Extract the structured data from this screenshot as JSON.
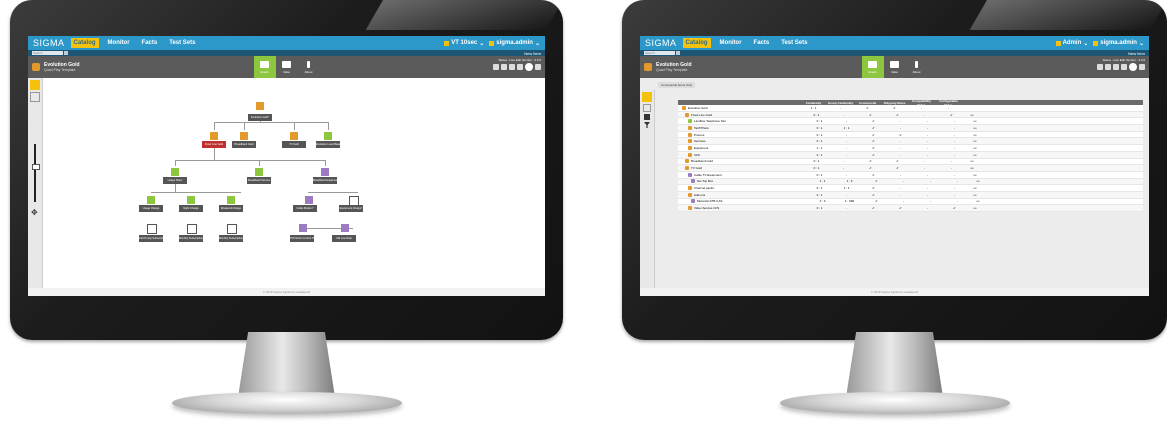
{
  "app": {
    "logo": "SIGMA",
    "nav": [
      "Catalog",
      "Monitor",
      "Facts",
      "Test Sets"
    ],
    "search_placeholder": "Search",
    "new_item": "New Item",
    "footer": "© 2019 Sigma Systems Canada LP"
  },
  "left": {
    "user1": "VT 10sec",
    "user2": "sigma.admin",
    "title": "Evolution Gold",
    "subtitle": "Quad Play Template",
    "modes": [
      "Graph",
      "Data",
      "About"
    ],
    "status": "Status : Live Edit  Version : 4.3.0",
    "nodes": [
      "Evolution Gold*",
      "Fixed Line Gold",
      "Broadband Gold",
      "TV Gold",
      "Evolution Level Based Discount",
      "Usage Plans",
      "Broadband Service",
      "Broadband Equipment",
      "Usage Charge",
      "Night Charge",
      "Weekend Charge",
      "Cable Modem*",
      "Equipment Charge*",
      "Call Timely Subscription Charge*",
      "Monthly Subscription Charge*",
      "Monthly Subscription Charge*",
      "TM Nimbo Control TSV",
      "CM Low Rate"
    ],
    "colors": {
      "green": "#8dc63f",
      "orange": "#e39a2b",
      "purple": "#9b7cc1",
      "red": "#bf2f2f"
    }
  },
  "right": {
    "user1": "Admin",
    "user2": "sigma.admin",
    "title": "Evolution Gold",
    "subtitle": "Quad Play Template",
    "modes": [
      "Graph",
      "Data",
      "About"
    ],
    "status": "Status : Live Edit  Version : 4.3.0",
    "tag": "Commercial Items Only",
    "columns": [
      "",
      "Cardinality",
      "Group Cardinality",
      "Commercial",
      "Shipping Rules",
      "Compatibility Rules",
      "Configurable Rules",
      ""
    ],
    "rows": [
      {
        "name": "Evolution Gold",
        "card": "1 : 1",
        "group": "-",
        "comm": "✔",
        "ship": "✔",
        "compat": "-",
        "conf": "-",
        "more": ""
      },
      {
        "name": "Fixed Line Gold",
        "card": "0 : 1",
        "group": "-",
        "comm": "✔",
        "ship": "✔",
        "compat": "-",
        "conf": "✔",
        "more": "•••"
      },
      {
        "name": "Landline Telephone Sim",
        "card": "0 : 1",
        "group": "-",
        "comm": "✔",
        "ship": "-",
        "compat": "-",
        "conf": "-",
        "more": "•••"
      },
      {
        "name": "Tariff Plans",
        "card": "0 : 1",
        "group": "1 : 1",
        "comm": "✔",
        "ship": "-",
        "compat": "-",
        "conf": "-",
        "more": "•••"
      },
      {
        "name": "Promos",
        "card": "0 : 1",
        "group": "-",
        "comm": "✔",
        "ship": "✔",
        "compat": "-",
        "conf": "-",
        "more": "•••"
      },
      {
        "name": "Services",
        "card": "0 : 1",
        "group": "-",
        "comm": "✔",
        "ship": "-",
        "compat": "-",
        "conf": "-",
        "more": "•••"
      },
      {
        "name": "Equipment",
        "card": "1 : 1",
        "group": "-",
        "comm": "✔",
        "ship": "-",
        "compat": "-",
        "conf": "-",
        "more": "•••"
      },
      {
        "name": "VAS",
        "card": "0 : 1",
        "group": "-",
        "comm": "✔",
        "ship": "-",
        "compat": "-",
        "conf": "-",
        "more": "•••"
      },
      {
        "name": "Broadband Gold",
        "card": "0 : 1",
        "group": "-",
        "comm": "✔",
        "ship": "✔",
        "compat": "-",
        "conf": "-",
        "more": "•••"
      },
      {
        "name": "TV Gold",
        "card": "0 : 1",
        "group": "-",
        "comm": "✔",
        "ship": "✔",
        "compat": "-",
        "conf": "-",
        "more": "•••"
      },
      {
        "name": "Cable TV Equipment",
        "card": "0 : 1",
        "group": "-",
        "comm": "✔",
        "ship": "-",
        "compat": "-",
        "conf": "-",
        "more": "•••"
      },
      {
        "name": "Set Top Box",
        "card": "1 : 1",
        "group": "1 : 3",
        "comm": "✔",
        "ship": "-",
        "compat": "-",
        "conf": "-",
        "more": "•••"
      },
      {
        "name": "Channel packs",
        "card": "0 : 1",
        "group": "1 : 1",
        "comm": "✔",
        "ship": "-",
        "compat": "-",
        "conf": "-",
        "more": "•••"
      },
      {
        "name": "Add-ons",
        "card": "0 : 1",
        "group": "-",
        "comm": "✔",
        "ship": "-",
        "compat": "-",
        "conf": "-",
        "more": "•••"
      },
      {
        "name": "Motorola STB CAS",
        "card": "2 : 3",
        "group": "1 : 999",
        "comm": "✔",
        "ship": "-",
        "compat": "-",
        "conf": "-",
        "more": "•••"
      },
      {
        "name": "Video Service CFS",
        "card": "0 : 1",
        "group": "-",
        "comm": "✔",
        "ship": "✔",
        "compat": "-",
        "conf": "✔",
        "more": "•••"
      }
    ]
  }
}
